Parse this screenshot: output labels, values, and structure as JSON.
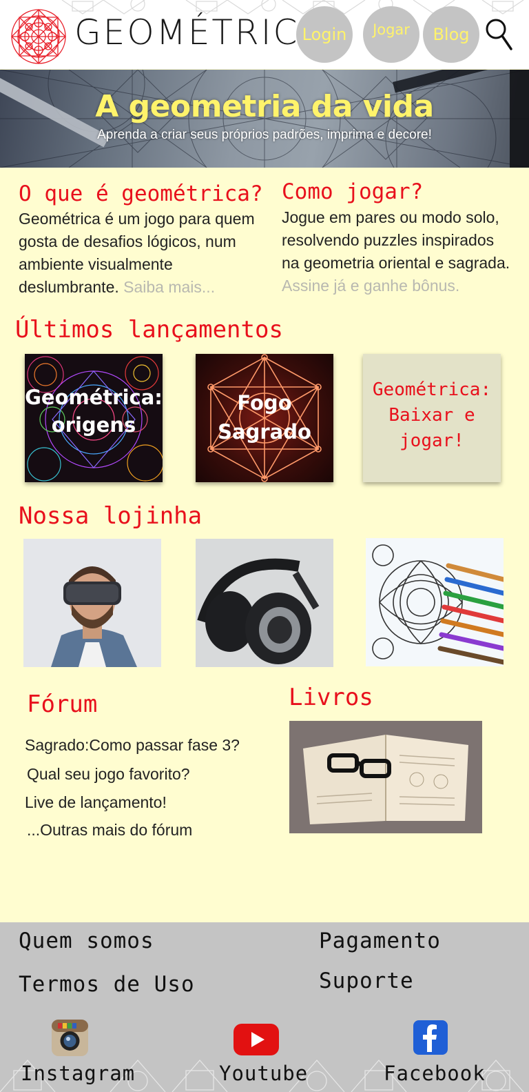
{
  "brand": {
    "name": "GEOMÉTRICA",
    "accent": "#e8101c",
    "yellow": "#fff36b",
    "cream": "#fffdd0"
  },
  "nav": {
    "login": "Login",
    "jogar": "Jogar",
    "blog": "Blog",
    "search_icon": "search-icon"
  },
  "hero": {
    "title": "A geometria da vida",
    "subtitle": "Aprenda a criar seus próprios  padrões, imprima e decore!"
  },
  "about": {
    "title": "O que é geométrica?",
    "text": "Geométrica é um jogo para quem gosta de desafios lógicos, num ambiente visualmente deslumbrante.",
    "more": "Saiba mais..."
  },
  "howto": {
    "title": "Como jogar?",
    "text": "Jogue em pares ou modo solo, resolvendo puzzles inspirados na geometria oriental e sagrada.",
    "more": "Assine já e ganhe bônus."
  },
  "releases": {
    "title": "Últimos lançamentos",
    "items": [
      {
        "line1": "Geométrica:",
        "line2": "origens"
      },
      {
        "line1": "Fogo",
        "line2": "Sagrado"
      },
      {
        "line1": "Geométrica:",
        "line2": "Baixar e",
        "line3": "jogar!"
      }
    ]
  },
  "shop": {
    "title": "Nossa lojinha"
  },
  "forum": {
    "title": "Fórum",
    "links": [
      "Sagrado:Como passar fase 3?",
      "Qual seu jogo favorito?",
      "Live de lançamento!"
    ],
    "more": "...Outras mais do fórum"
  },
  "books": {
    "title": "Livros"
  },
  "footer": {
    "links": {
      "about": "Quem somos",
      "terms": "Termos de Uso",
      "payment": "Pagamento",
      "support": "Suporte"
    },
    "social": {
      "instagram": "Instagram",
      "youtube": "Youtube",
      "facebook": "Facebook"
    }
  }
}
